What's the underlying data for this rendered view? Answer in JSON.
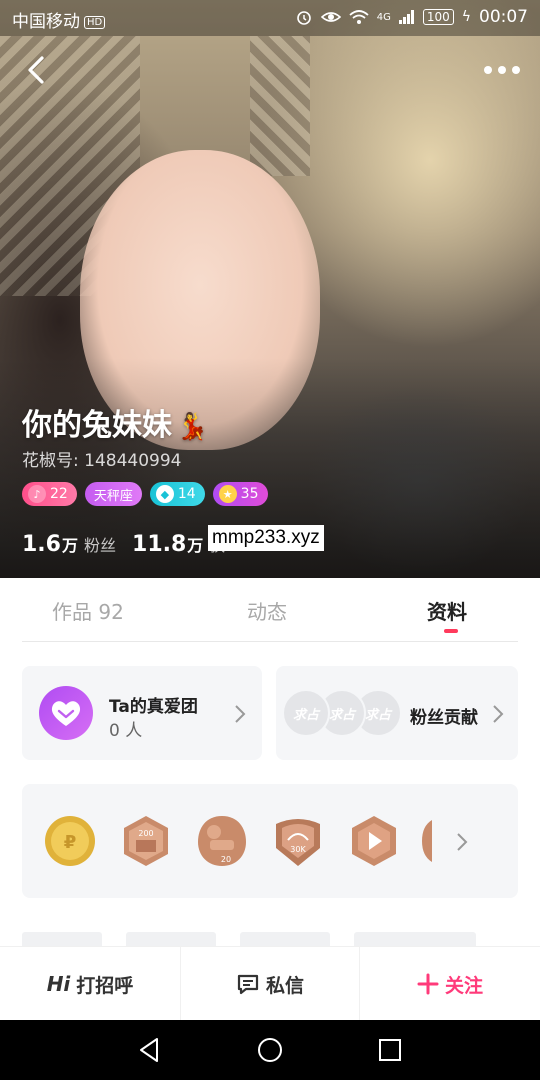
{
  "status_bar": {
    "carrier": "中国移动",
    "hd_badge": "HD",
    "network": "4G",
    "battery": "100",
    "time": "00:07"
  },
  "profile": {
    "nickname": "你的兔妹妹",
    "nickname_emoji": "💃",
    "user_id": "花椒号: 148440994",
    "badges": {
      "level": "22",
      "zodiac": "天秤座",
      "diamond": "14",
      "star": "35"
    },
    "stats": {
      "fans_num": "1.6",
      "fans_unit": "万",
      "fans_label": "粉丝",
      "likes_num": "11.8",
      "likes_unit": "万",
      "likes_label": "获"
    },
    "watermark": "mmp233.xyz"
  },
  "tabs": [
    {
      "label": "作品 92",
      "active": false
    },
    {
      "label": "动态",
      "active": false
    },
    {
      "label": "资料",
      "active": true
    }
  ],
  "fan_club": {
    "title": "Ta的真爱团",
    "count": "0 人"
  },
  "contribution": {
    "placeholder": "求占",
    "title": "粉丝贡献"
  },
  "medals": [
    {
      "name": "gold-medal",
      "text": "",
      "color": "#e0b23a"
    },
    {
      "name": "medal-200",
      "text": "200",
      "color": "#c98b6a"
    },
    {
      "name": "medal-20",
      "text": "20",
      "color": "#c98b6a"
    },
    {
      "name": "medal-30k",
      "text": "30K",
      "color": "#b87a5a"
    },
    {
      "name": "medal-play",
      "text": "",
      "color": "#c98b6a"
    }
  ],
  "actions": {
    "greet_prefix": "Hi",
    "greet": "打招呼",
    "message": "私信",
    "follow": "关注"
  },
  "colors": {
    "accent": "#ff3a7a",
    "tab_indicator": "#ff3a5c",
    "fan_club": "#b04cf2"
  }
}
